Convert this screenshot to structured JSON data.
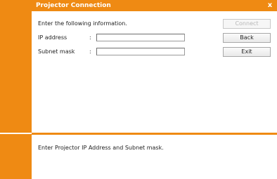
{
  "window": {
    "title": "Projector Connection",
    "close_glyph": "x"
  },
  "form": {
    "instruction": "Enter the following information.",
    "colon": ":",
    "ip_label": "IP address",
    "ip_value": "",
    "subnet_label": "Subnet mask",
    "subnet_value": ""
  },
  "buttons": {
    "connect": "Connect",
    "back": "Back",
    "exit": "Exit"
  },
  "status": {
    "message": "Enter Projector IP Address and Subnet mask."
  },
  "colors": {
    "accent": "#ef8a13",
    "background": "#ffffff"
  }
}
